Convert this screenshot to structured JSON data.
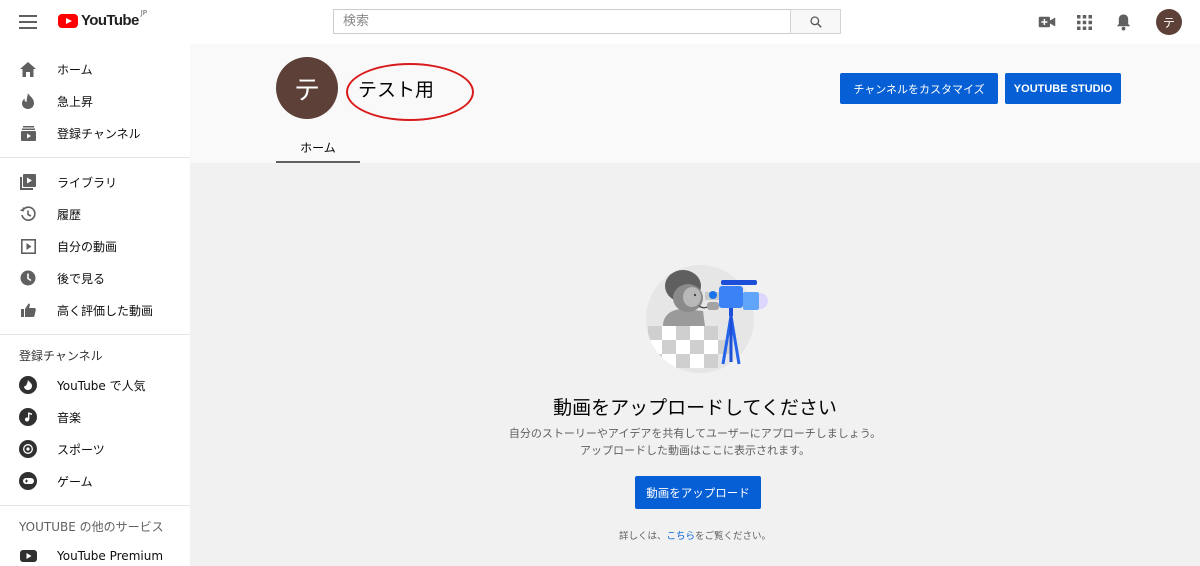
{
  "header": {
    "logo_text": "YouTube",
    "logo_region": "JP",
    "search_placeholder": "検索",
    "avatar_letter": "テ"
  },
  "sidebar": {
    "main_items": [
      {
        "label": "ホーム",
        "icon": "home-icon"
      },
      {
        "label": "急上昇",
        "icon": "trending-icon"
      },
      {
        "label": "登録チャンネル",
        "icon": "subscriptions-icon"
      }
    ],
    "library_items": [
      {
        "label": "ライブラリ",
        "icon": "library-icon"
      },
      {
        "label": "履歴",
        "icon": "history-icon"
      },
      {
        "label": "自分の動画",
        "icon": "your-videos-icon"
      },
      {
        "label": "後で見る",
        "icon": "watch-later-icon"
      },
      {
        "label": "高く評価した動画",
        "icon": "liked-videos-icon"
      }
    ],
    "subscriptions_heading": "登録チャンネル",
    "subscriptions": [
      {
        "label": "YouTube で人気",
        "icon": "popular-icon"
      },
      {
        "label": "音楽",
        "icon": "music-icon"
      },
      {
        "label": "スポーツ",
        "icon": "sports-icon"
      },
      {
        "label": "ゲーム",
        "icon": "gaming-icon"
      }
    ],
    "more_heading": "YOUTUBE の他のサービス",
    "more_items": [
      {
        "label": "YouTube Premium",
        "icon": "youtube-premium-icon"
      }
    ]
  },
  "channel": {
    "avatar_letter": "テ",
    "name": "テスト用",
    "customize_button": "チャンネルをカスタマイズ",
    "studio_button": "YOUTUBE STUDIO",
    "tabs": [
      "ホーム"
    ]
  },
  "empty_state": {
    "title": "動画をアップロードしてください",
    "description_line1": "自分のストーリーやアイデアを共有してユーザーにアプローチしましょう。",
    "description_line2": "アップロードした動画はここに表示されます。",
    "upload_button": "動画をアップロード",
    "learn_prefix": "詳しくは、",
    "learn_link": "こちら",
    "learn_suffix": "をご覧ください。"
  },
  "colors": {
    "brand_red": "#ff0000",
    "accent_blue": "#065fd4",
    "avatar_brown": "#5d4037",
    "annotation_red": "#d91a1a"
  }
}
